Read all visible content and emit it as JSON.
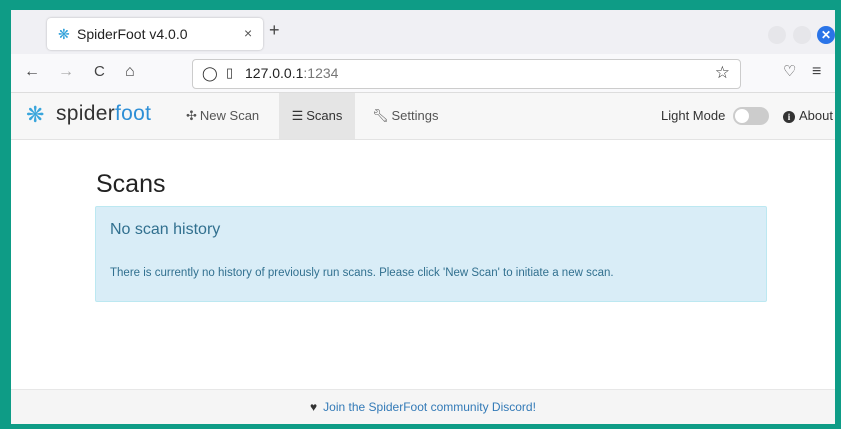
{
  "browser": {
    "tab_title": "SpiderFoot v4.0.0",
    "tab_close": "×",
    "new_tab": "+",
    "url_host": "127.0.0.1",
    "url_port": ":1234",
    "icons": {
      "back": "←",
      "forward": "→",
      "reload": "C",
      "home": "⌂",
      "bookmark": "☆",
      "pocket": "♡",
      "menu": "≡"
    }
  },
  "app": {
    "brand_a": "spider",
    "brand_b": "foot",
    "nav": {
      "new_scan": "New Scan",
      "scans": "Scans",
      "settings": "Settings"
    },
    "light_mode": "Light Mode",
    "about": "About"
  },
  "main": {
    "title": "Scans",
    "alert_title": "No scan history",
    "alert_body": "There is currently no history of previously run scans. Please click 'New Scan' to initiate a new scan."
  },
  "footer": {
    "link": "Join the SpiderFoot community Discord!"
  },
  "colors": {
    "desktop": "#0e9c86",
    "brand_blue": "#2e8fd6",
    "alert_bg": "#d9edf7",
    "alert_text": "#31708f"
  }
}
